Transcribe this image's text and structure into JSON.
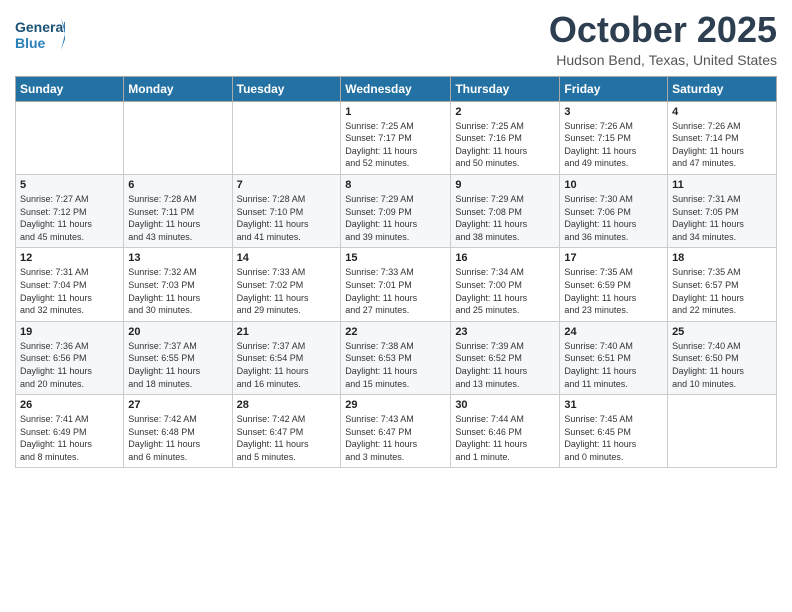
{
  "header": {
    "logo_line1": "General",
    "logo_line2": "Blue",
    "month": "October 2025",
    "location": "Hudson Bend, Texas, United States"
  },
  "days_of_week": [
    "Sunday",
    "Monday",
    "Tuesday",
    "Wednesday",
    "Thursday",
    "Friday",
    "Saturday"
  ],
  "weeks": [
    [
      {
        "day": "",
        "info": ""
      },
      {
        "day": "",
        "info": ""
      },
      {
        "day": "",
        "info": ""
      },
      {
        "day": "1",
        "info": "Sunrise: 7:25 AM\nSunset: 7:17 PM\nDaylight: 11 hours\nand 52 minutes."
      },
      {
        "day": "2",
        "info": "Sunrise: 7:25 AM\nSunset: 7:16 PM\nDaylight: 11 hours\nand 50 minutes."
      },
      {
        "day": "3",
        "info": "Sunrise: 7:26 AM\nSunset: 7:15 PM\nDaylight: 11 hours\nand 49 minutes."
      },
      {
        "day": "4",
        "info": "Sunrise: 7:26 AM\nSunset: 7:14 PM\nDaylight: 11 hours\nand 47 minutes."
      }
    ],
    [
      {
        "day": "5",
        "info": "Sunrise: 7:27 AM\nSunset: 7:12 PM\nDaylight: 11 hours\nand 45 minutes."
      },
      {
        "day": "6",
        "info": "Sunrise: 7:28 AM\nSunset: 7:11 PM\nDaylight: 11 hours\nand 43 minutes."
      },
      {
        "day": "7",
        "info": "Sunrise: 7:28 AM\nSunset: 7:10 PM\nDaylight: 11 hours\nand 41 minutes."
      },
      {
        "day": "8",
        "info": "Sunrise: 7:29 AM\nSunset: 7:09 PM\nDaylight: 11 hours\nand 39 minutes."
      },
      {
        "day": "9",
        "info": "Sunrise: 7:29 AM\nSunset: 7:08 PM\nDaylight: 11 hours\nand 38 minutes."
      },
      {
        "day": "10",
        "info": "Sunrise: 7:30 AM\nSunset: 7:06 PM\nDaylight: 11 hours\nand 36 minutes."
      },
      {
        "day": "11",
        "info": "Sunrise: 7:31 AM\nSunset: 7:05 PM\nDaylight: 11 hours\nand 34 minutes."
      }
    ],
    [
      {
        "day": "12",
        "info": "Sunrise: 7:31 AM\nSunset: 7:04 PM\nDaylight: 11 hours\nand 32 minutes."
      },
      {
        "day": "13",
        "info": "Sunrise: 7:32 AM\nSunset: 7:03 PM\nDaylight: 11 hours\nand 30 minutes."
      },
      {
        "day": "14",
        "info": "Sunrise: 7:33 AM\nSunset: 7:02 PM\nDaylight: 11 hours\nand 29 minutes."
      },
      {
        "day": "15",
        "info": "Sunrise: 7:33 AM\nSunset: 7:01 PM\nDaylight: 11 hours\nand 27 minutes."
      },
      {
        "day": "16",
        "info": "Sunrise: 7:34 AM\nSunset: 7:00 PM\nDaylight: 11 hours\nand 25 minutes."
      },
      {
        "day": "17",
        "info": "Sunrise: 7:35 AM\nSunset: 6:59 PM\nDaylight: 11 hours\nand 23 minutes."
      },
      {
        "day": "18",
        "info": "Sunrise: 7:35 AM\nSunset: 6:57 PM\nDaylight: 11 hours\nand 22 minutes."
      }
    ],
    [
      {
        "day": "19",
        "info": "Sunrise: 7:36 AM\nSunset: 6:56 PM\nDaylight: 11 hours\nand 20 minutes."
      },
      {
        "day": "20",
        "info": "Sunrise: 7:37 AM\nSunset: 6:55 PM\nDaylight: 11 hours\nand 18 minutes."
      },
      {
        "day": "21",
        "info": "Sunrise: 7:37 AM\nSunset: 6:54 PM\nDaylight: 11 hours\nand 16 minutes."
      },
      {
        "day": "22",
        "info": "Sunrise: 7:38 AM\nSunset: 6:53 PM\nDaylight: 11 hours\nand 15 minutes."
      },
      {
        "day": "23",
        "info": "Sunrise: 7:39 AM\nSunset: 6:52 PM\nDaylight: 11 hours\nand 13 minutes."
      },
      {
        "day": "24",
        "info": "Sunrise: 7:40 AM\nSunset: 6:51 PM\nDaylight: 11 hours\nand 11 minutes."
      },
      {
        "day": "25",
        "info": "Sunrise: 7:40 AM\nSunset: 6:50 PM\nDaylight: 11 hours\nand 10 minutes."
      }
    ],
    [
      {
        "day": "26",
        "info": "Sunrise: 7:41 AM\nSunset: 6:49 PM\nDaylight: 11 hours\nand 8 minutes."
      },
      {
        "day": "27",
        "info": "Sunrise: 7:42 AM\nSunset: 6:48 PM\nDaylight: 11 hours\nand 6 minutes."
      },
      {
        "day": "28",
        "info": "Sunrise: 7:42 AM\nSunset: 6:47 PM\nDaylight: 11 hours\nand 5 minutes."
      },
      {
        "day": "29",
        "info": "Sunrise: 7:43 AM\nSunset: 6:47 PM\nDaylight: 11 hours\nand 3 minutes."
      },
      {
        "day": "30",
        "info": "Sunrise: 7:44 AM\nSunset: 6:46 PM\nDaylight: 11 hours\nand 1 minute."
      },
      {
        "day": "31",
        "info": "Sunrise: 7:45 AM\nSunset: 6:45 PM\nDaylight: 11 hours\nand 0 minutes."
      },
      {
        "day": "",
        "info": ""
      }
    ]
  ]
}
